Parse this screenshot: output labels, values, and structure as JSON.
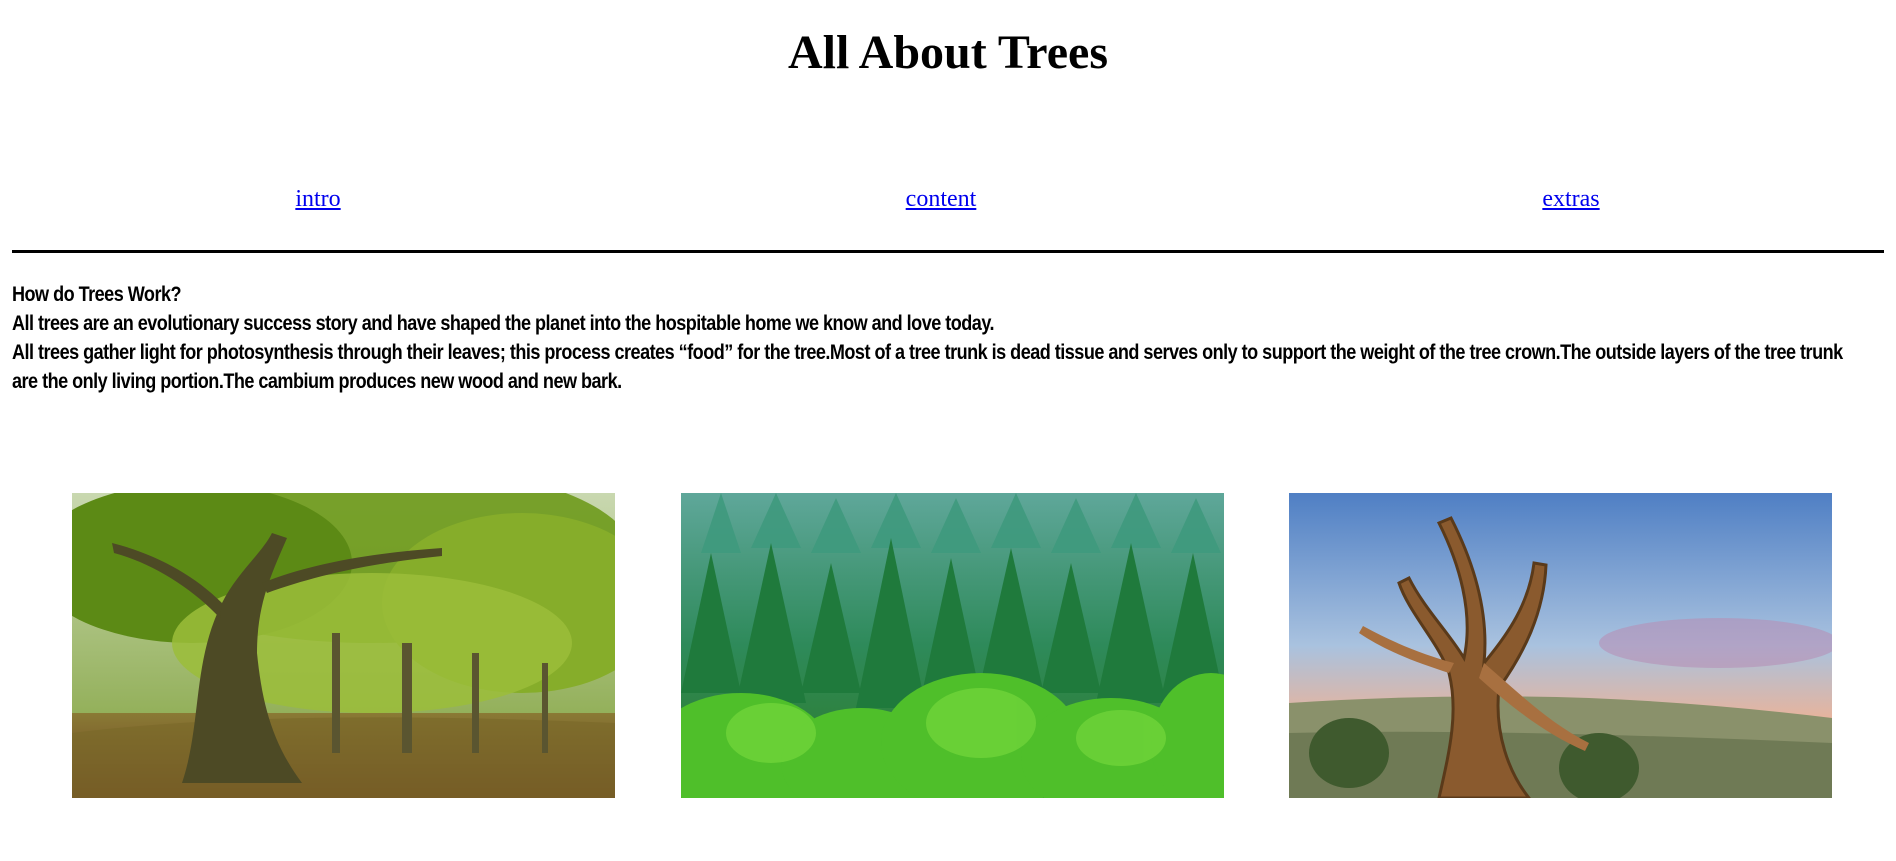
{
  "page": {
    "title": "All About Trees"
  },
  "nav": {
    "links": [
      "intro",
      "content",
      "extras"
    ]
  },
  "content": {
    "heading": "How do Trees Work?",
    "paragraph1": "All trees are an evolutionary success story and have shaped the planet into the hospitable home we know and love today.",
    "paragraph2": "All trees gather light for photosynthesis through their leaves; this process creates “food” for the tree.Most of a tree trunk is dead tissue and serves only to support the weight of the tree crown.The outside layers of the tree trunk are the only living portion.The cambium produces new wood and new bark."
  },
  "images": [
    {
      "subject": "green forest with large old tree",
      "icon": "forest-photo"
    },
    {
      "subject": "dense conifer forest canopy",
      "icon": "conifer-photo"
    },
    {
      "subject": "twisted bristlecone pine at sunset",
      "icon": "bristlecone-photo"
    }
  ],
  "colors": {
    "link": "#0000ee",
    "rule": "#000000"
  }
}
